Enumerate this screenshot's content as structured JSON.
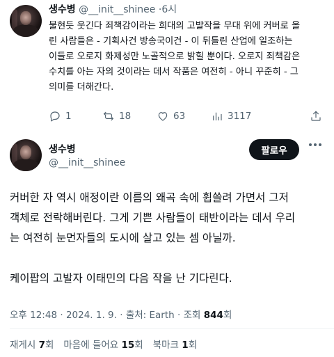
{
  "reply_tweet": {
    "display_name": "생수병",
    "handle": "@__init__shinee",
    "time": "6시",
    "body_lines": [
      "불현듯 웃긴다 죄책감이라는 희대의 고발작을 무대 위에 커버로 올",
      "린 사람들은 - 기획사건 방송국이건 - 이 뒤틀린 산업에 일조하는",
      "이들로 오로지 화제성만 노골적으로 밝힐 뿐이다. 오로지 죄책감은",
      "수치를 아는 자의 것이라는 데서 작품은 여전히 - 아니 꾸준히 - 그",
      "의미를 더해간다."
    ],
    "actions": {
      "reply_count": "1",
      "retweet_count": "18",
      "like_count": "63",
      "view_count": "3117"
    }
  },
  "main_tweet": {
    "display_name": "생수병",
    "handle": "@__init__shinee",
    "follow_label": "팔로우",
    "body_lines": [
      "커버한 자 역시 애정이란 이름의 왜곡 속에 휩쓸려 가면서 그저",
      "객체로 전락해버린다. 그게 기쁜 사람들이 태반이라는 데서 우리",
      "는 여전히 눈먼자들의 도시에 살고 있는 셈 아닐까."
    ],
    "body_lines_2": [
      "케이팝의 고발자 이태민의 다음 작을 난 기다린다."
    ],
    "meta": {
      "time": "오후 12:48",
      "date": "2024. 1. 9.",
      "source": "출처: Earth",
      "views_label": "조회",
      "views_count": "844",
      "views_suffix": "회"
    },
    "stats": {
      "retweets_label": "재게시",
      "retweets_count": "7",
      "likes_label": "마음에 들어요",
      "likes_count": "15",
      "bookmarks_label": "북마크",
      "bookmarks_count": "1",
      "suffix": "회"
    }
  }
}
